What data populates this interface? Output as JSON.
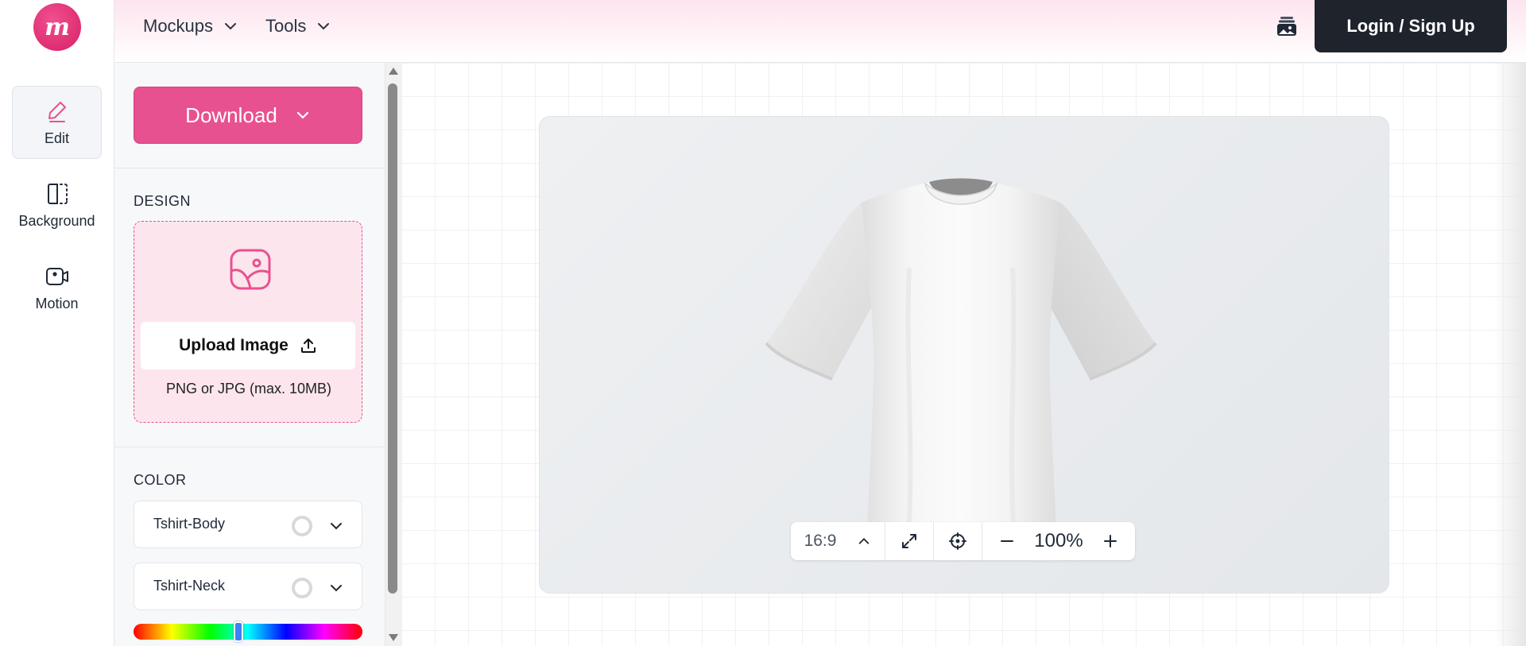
{
  "app": {
    "logo_text": "m"
  },
  "nav": {
    "items": [
      {
        "label": "Mockups"
      },
      {
        "label": "Tools"
      }
    ],
    "login_label": "Login / Sign Up"
  },
  "rail": {
    "items": [
      {
        "label": "Edit",
        "icon": "pencil-icon",
        "active": true
      },
      {
        "label": "Background",
        "icon": "background-icon",
        "active": false
      },
      {
        "label": "Motion",
        "icon": "camera-icon",
        "active": false
      }
    ]
  },
  "panel": {
    "download_label": "Download",
    "design": {
      "heading": "DESIGN",
      "upload_label": "Upload Image",
      "upload_hint": "PNG or JPG (max. 10MB)"
    },
    "color": {
      "heading": "COLOR",
      "parts": [
        {
          "label": "Tshirt-Body",
          "swatch": "#ffffff"
        },
        {
          "label": "Tshirt-Neck",
          "swatch": "#ffffff"
        }
      ],
      "hue_value": 0.46
    }
  },
  "toolbar": {
    "ratio": "16:9",
    "zoom": "100%"
  },
  "colors": {
    "accent": "#e8518f",
    "dark": "#1e232c"
  }
}
